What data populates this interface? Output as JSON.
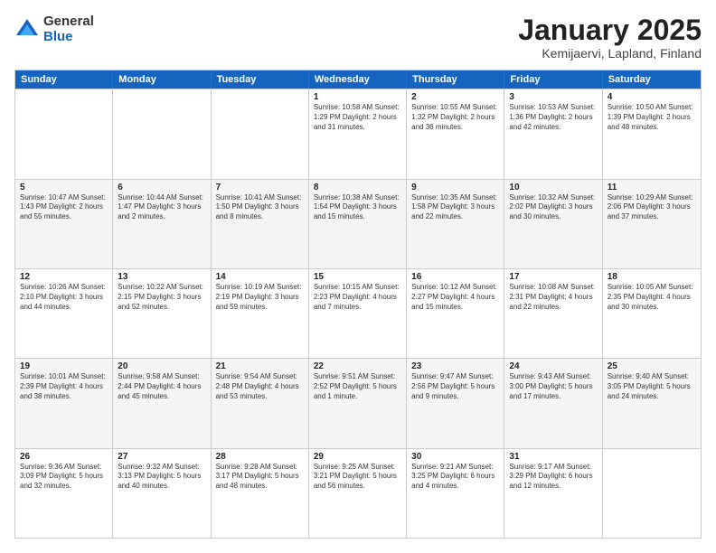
{
  "logo": {
    "general": "General",
    "blue": "Blue"
  },
  "title": "January 2025",
  "location": "Kemijaervi, Lapland, Finland",
  "weekdays": [
    "Sunday",
    "Monday",
    "Tuesday",
    "Wednesday",
    "Thursday",
    "Friday",
    "Saturday"
  ],
  "rows": [
    [
      {
        "day": "",
        "text": ""
      },
      {
        "day": "",
        "text": ""
      },
      {
        "day": "",
        "text": ""
      },
      {
        "day": "1",
        "text": "Sunrise: 10:58 AM\nSunset: 1:29 PM\nDaylight: 2 hours\nand 31 minutes."
      },
      {
        "day": "2",
        "text": "Sunrise: 10:55 AM\nSunset: 1:32 PM\nDaylight: 2 hours\nand 36 minutes."
      },
      {
        "day": "3",
        "text": "Sunrise: 10:53 AM\nSunset: 1:36 PM\nDaylight: 2 hours\nand 42 minutes."
      },
      {
        "day": "4",
        "text": "Sunrise: 10:50 AM\nSunset: 1:39 PM\nDaylight: 2 hours\nand 48 minutes."
      }
    ],
    [
      {
        "day": "5",
        "text": "Sunrise: 10:47 AM\nSunset: 1:43 PM\nDaylight: 2 hours\nand 55 minutes."
      },
      {
        "day": "6",
        "text": "Sunrise: 10:44 AM\nSunset: 1:47 PM\nDaylight: 3 hours\nand 2 minutes."
      },
      {
        "day": "7",
        "text": "Sunrise: 10:41 AM\nSunset: 1:50 PM\nDaylight: 3 hours\nand 8 minutes."
      },
      {
        "day": "8",
        "text": "Sunrise: 10:38 AM\nSunset: 1:54 PM\nDaylight: 3 hours\nand 15 minutes."
      },
      {
        "day": "9",
        "text": "Sunrise: 10:35 AM\nSunset: 1:58 PM\nDaylight: 3 hours\nand 22 minutes."
      },
      {
        "day": "10",
        "text": "Sunrise: 10:32 AM\nSunset: 2:02 PM\nDaylight: 3 hours\nand 30 minutes."
      },
      {
        "day": "11",
        "text": "Sunrise: 10:29 AM\nSunset: 2:06 PM\nDaylight: 3 hours\nand 37 minutes."
      }
    ],
    [
      {
        "day": "12",
        "text": "Sunrise: 10:26 AM\nSunset: 2:10 PM\nDaylight: 3 hours\nand 44 minutes."
      },
      {
        "day": "13",
        "text": "Sunrise: 10:22 AM\nSunset: 2:15 PM\nDaylight: 3 hours\nand 52 minutes."
      },
      {
        "day": "14",
        "text": "Sunrise: 10:19 AM\nSunset: 2:19 PM\nDaylight: 3 hours\nand 59 minutes."
      },
      {
        "day": "15",
        "text": "Sunrise: 10:15 AM\nSunset: 2:23 PM\nDaylight: 4 hours\nand 7 minutes."
      },
      {
        "day": "16",
        "text": "Sunrise: 10:12 AM\nSunset: 2:27 PM\nDaylight: 4 hours\nand 15 minutes."
      },
      {
        "day": "17",
        "text": "Sunrise: 10:08 AM\nSunset: 2:31 PM\nDaylight: 4 hours\nand 22 minutes."
      },
      {
        "day": "18",
        "text": "Sunrise: 10:05 AM\nSunset: 2:35 PM\nDaylight: 4 hours\nand 30 minutes."
      }
    ],
    [
      {
        "day": "19",
        "text": "Sunrise: 10:01 AM\nSunset: 2:39 PM\nDaylight: 4 hours\nand 38 minutes."
      },
      {
        "day": "20",
        "text": "Sunrise: 9:58 AM\nSunset: 2:44 PM\nDaylight: 4 hours\nand 45 minutes."
      },
      {
        "day": "21",
        "text": "Sunrise: 9:54 AM\nSunset: 2:48 PM\nDaylight: 4 hours\nand 53 minutes."
      },
      {
        "day": "22",
        "text": "Sunrise: 9:51 AM\nSunset: 2:52 PM\nDaylight: 5 hours\nand 1 minute."
      },
      {
        "day": "23",
        "text": "Sunrise: 9:47 AM\nSunset: 2:56 PM\nDaylight: 5 hours\nand 9 minutes."
      },
      {
        "day": "24",
        "text": "Sunrise: 9:43 AM\nSunset: 3:00 PM\nDaylight: 5 hours\nand 17 minutes."
      },
      {
        "day": "25",
        "text": "Sunrise: 9:40 AM\nSunset: 3:05 PM\nDaylight: 5 hours\nand 24 minutes."
      }
    ],
    [
      {
        "day": "26",
        "text": "Sunrise: 9:36 AM\nSunset: 3:09 PM\nDaylight: 5 hours\nand 32 minutes."
      },
      {
        "day": "27",
        "text": "Sunrise: 9:32 AM\nSunset: 3:13 PM\nDaylight: 5 hours\nand 40 minutes."
      },
      {
        "day": "28",
        "text": "Sunrise: 9:28 AM\nSunset: 3:17 PM\nDaylight: 5 hours\nand 48 minutes."
      },
      {
        "day": "29",
        "text": "Sunrise: 9:25 AM\nSunset: 3:21 PM\nDaylight: 5 hours\nand 56 minutes."
      },
      {
        "day": "30",
        "text": "Sunrise: 9:21 AM\nSunset: 3:25 PM\nDaylight: 6 hours\nand 4 minutes."
      },
      {
        "day": "31",
        "text": "Sunrise: 9:17 AM\nSunset: 3:29 PM\nDaylight: 6 hours\nand 12 minutes."
      },
      {
        "day": "",
        "text": ""
      }
    ]
  ]
}
